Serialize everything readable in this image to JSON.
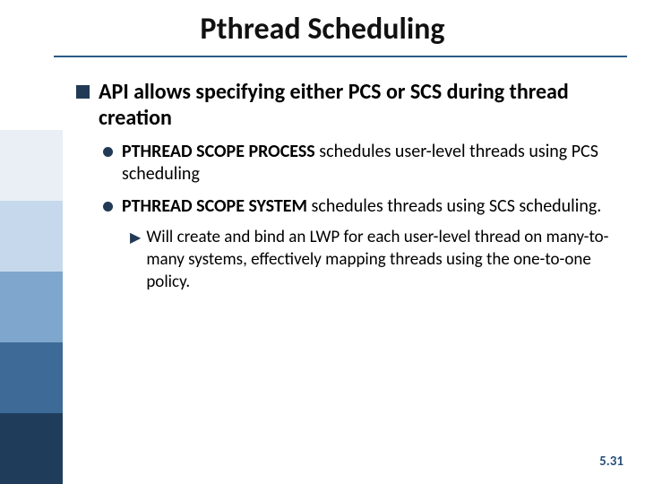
{
  "title": "Pthread Scheduling",
  "lvl1": {
    "text": "API allows specifying either PCS or SCS during thread creation"
  },
  "b1": {
    "bold": "PTHREAD SCOPE PROCESS",
    "rest": " schedules user-level threads using PCS scheduling"
  },
  "b2": {
    "bold": "PTHREAD SCOPE SYSTEM",
    "rest": " schedules threads using SCS scheduling."
  },
  "sub": {
    "text": "Will create and bind an LWP for each user-level thread on many-to-many systems, effectively mapping threads using the one-to-one policy."
  },
  "pagenum": "5.31"
}
